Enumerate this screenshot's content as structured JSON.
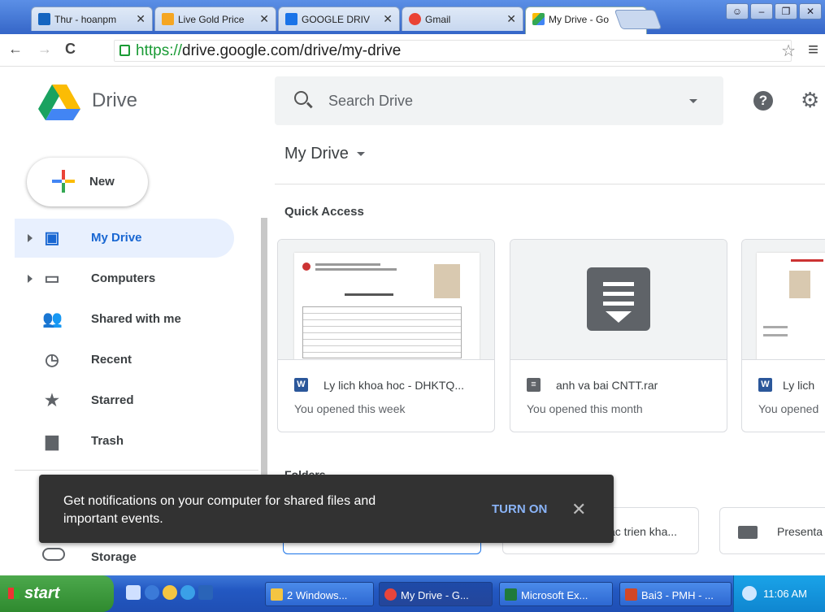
{
  "browser": {
    "tabs": [
      {
        "title": "Thư - hoanpm",
        "favicon_color": "#1565c0"
      },
      {
        "title": "Live Gold Price",
        "favicon_color": "#f5a623"
      },
      {
        "title": "GOOGLE DRIV",
        "favicon_color": "#1a73e8"
      },
      {
        "title": "Gmail",
        "favicon_color": "#ea4335"
      },
      {
        "title": "My Drive - Go",
        "favicon_color": "#fbbc04"
      }
    ],
    "url_secure": "https://",
    "url_rest": "drive.google.com/drive/my-drive"
  },
  "header": {
    "app_name": "Drive",
    "search_placeholder": "Search Drive",
    "help_label": "?"
  },
  "sidebar": {
    "new_label": "New",
    "items": [
      {
        "label": "My Drive",
        "icon": "drive-icon",
        "glyph": "▣",
        "active": true,
        "expandable": true
      },
      {
        "label": "Computers",
        "icon": "computers-icon",
        "glyph": "▭",
        "active": false,
        "expandable": true
      },
      {
        "label": "Shared with me",
        "icon": "people-icon",
        "glyph": "👥",
        "active": false,
        "expandable": false
      },
      {
        "label": "Recent",
        "icon": "clock-icon",
        "glyph": "◷",
        "active": false,
        "expandable": false
      },
      {
        "label": "Starred",
        "icon": "star-icon",
        "glyph": "★",
        "active": false,
        "expandable": false
      },
      {
        "label": "Trash",
        "icon": "trash-icon",
        "glyph": "▆",
        "active": false,
        "expandable": false
      }
    ],
    "storage_label": "Storage"
  },
  "main": {
    "title": "My Drive",
    "quick_access_title": "Quick Access",
    "quick_access": [
      {
        "name": "Ly lich khoa hoc - DHKTQ...",
        "opened": "You opened this week",
        "type": "W",
        "type_color": "#2b579a"
      },
      {
        "name": "anh va bai CNTT.rar",
        "opened": "You opened this month",
        "type": "≡",
        "type_color": "#5f6368"
      },
      {
        "name": "Ly lich",
        "opened": "You opened",
        "type": "W",
        "type_color": "#2b579a"
      }
    ],
    "folders_title": "Folders",
    "folders": [
      {
        "name": ""
      },
      {
        "name": "ac trien kha..."
      },
      {
        "name": "Presenta"
      }
    ]
  },
  "snackbar": {
    "message": "Get notifications on your computer for shared files and important events.",
    "action": "TURN ON",
    "close": "✕"
  },
  "taskbar": {
    "start_label": "start",
    "tasks": [
      {
        "label": "2 Windows...",
        "icon_color": "#f4c542"
      },
      {
        "label": "My Drive - G...",
        "icon_color": "#e8453c"
      },
      {
        "label": "Microsoft Ex...",
        "icon_color": "#1f7a3a"
      },
      {
        "label": "Bai3 - PMH - ...",
        "icon_color": "#d24726"
      }
    ],
    "clock": "11:06 AM"
  }
}
